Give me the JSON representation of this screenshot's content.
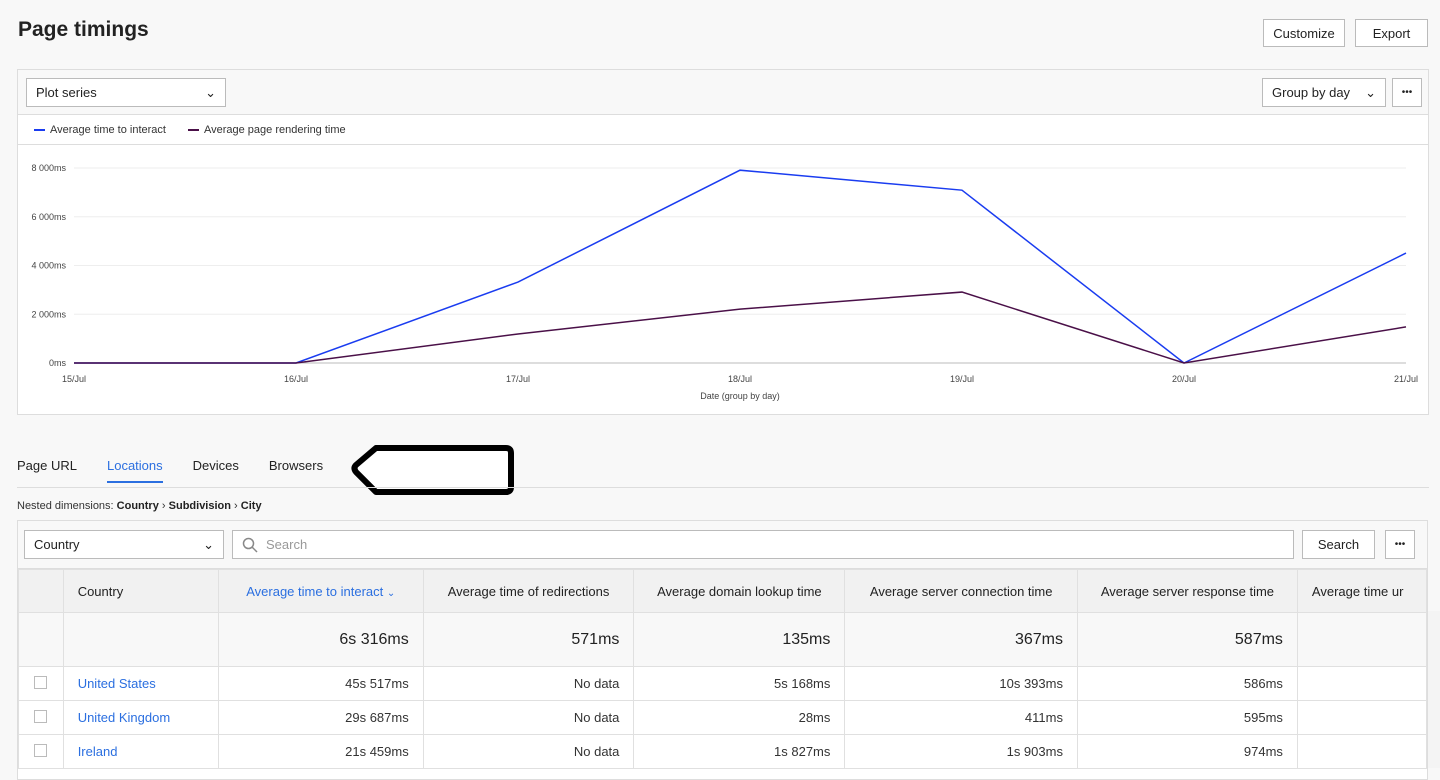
{
  "header": {
    "title": "Page timings",
    "customize": "Customize",
    "export": "Export"
  },
  "chart_toolbar": {
    "plot_series": "Plot series",
    "group_by": "Group by day",
    "more": "•••"
  },
  "chart_data": {
    "type": "line",
    "x": [
      "15/Jul",
      "16/Jul",
      "17/Jul",
      "18/Jul",
      "19/Jul",
      "20/Jul",
      "21/Jul"
    ],
    "xlabel": "Date (group by day)",
    "yticks": [
      "0ms",
      "2 000ms",
      "4 000ms",
      "6 000ms",
      "8 000ms"
    ],
    "ylim": [
      0,
      8000
    ],
    "grid": true,
    "legend": "top-left",
    "series": [
      {
        "name": "Average time to interact",
        "color": "#1a3cf0",
        "values": [
          0,
          0,
          3320,
          7910,
          7090,
          0,
          4510
        ]
      },
      {
        "name": "Average page rendering time",
        "color": "#4a1048",
        "values": [
          0,
          0,
          1190,
          2210,
          2910,
          0,
          1480
        ]
      }
    ]
  },
  "tabs": [
    {
      "label": "Page URL"
    },
    {
      "label": "Locations",
      "active": true
    },
    {
      "label": "Devices"
    },
    {
      "label": "Browsers"
    }
  ],
  "nested": {
    "prefix": "Nested dimensions:",
    "path": [
      "Country",
      "Subdivision",
      "City"
    ],
    "sep": "›"
  },
  "table_toolbar": {
    "dimension": "Country",
    "search_placeholder": "Search",
    "search_button": "Search",
    "more": "•••"
  },
  "table": {
    "columns": [
      "Country",
      "Average time to interact",
      "Average time of redirections",
      "Average domain lookup time",
      "Average server connection time",
      "Average server response time",
      "Average time ur"
    ],
    "summary": [
      "",
      "6s 316ms",
      "571ms",
      "135ms",
      "367ms",
      "587ms",
      ""
    ],
    "rows": [
      [
        "United States",
        "45s 517ms",
        "No data",
        "5s 168ms",
        "10s 393ms",
        "586ms",
        ""
      ],
      [
        "United Kingdom",
        "29s 687ms",
        "No data",
        "28ms",
        "411ms",
        "595ms",
        ""
      ],
      [
        "Ireland",
        "21s 459ms",
        "No data",
        "1s 827ms",
        "1s 903ms",
        "974ms",
        ""
      ]
    ]
  }
}
